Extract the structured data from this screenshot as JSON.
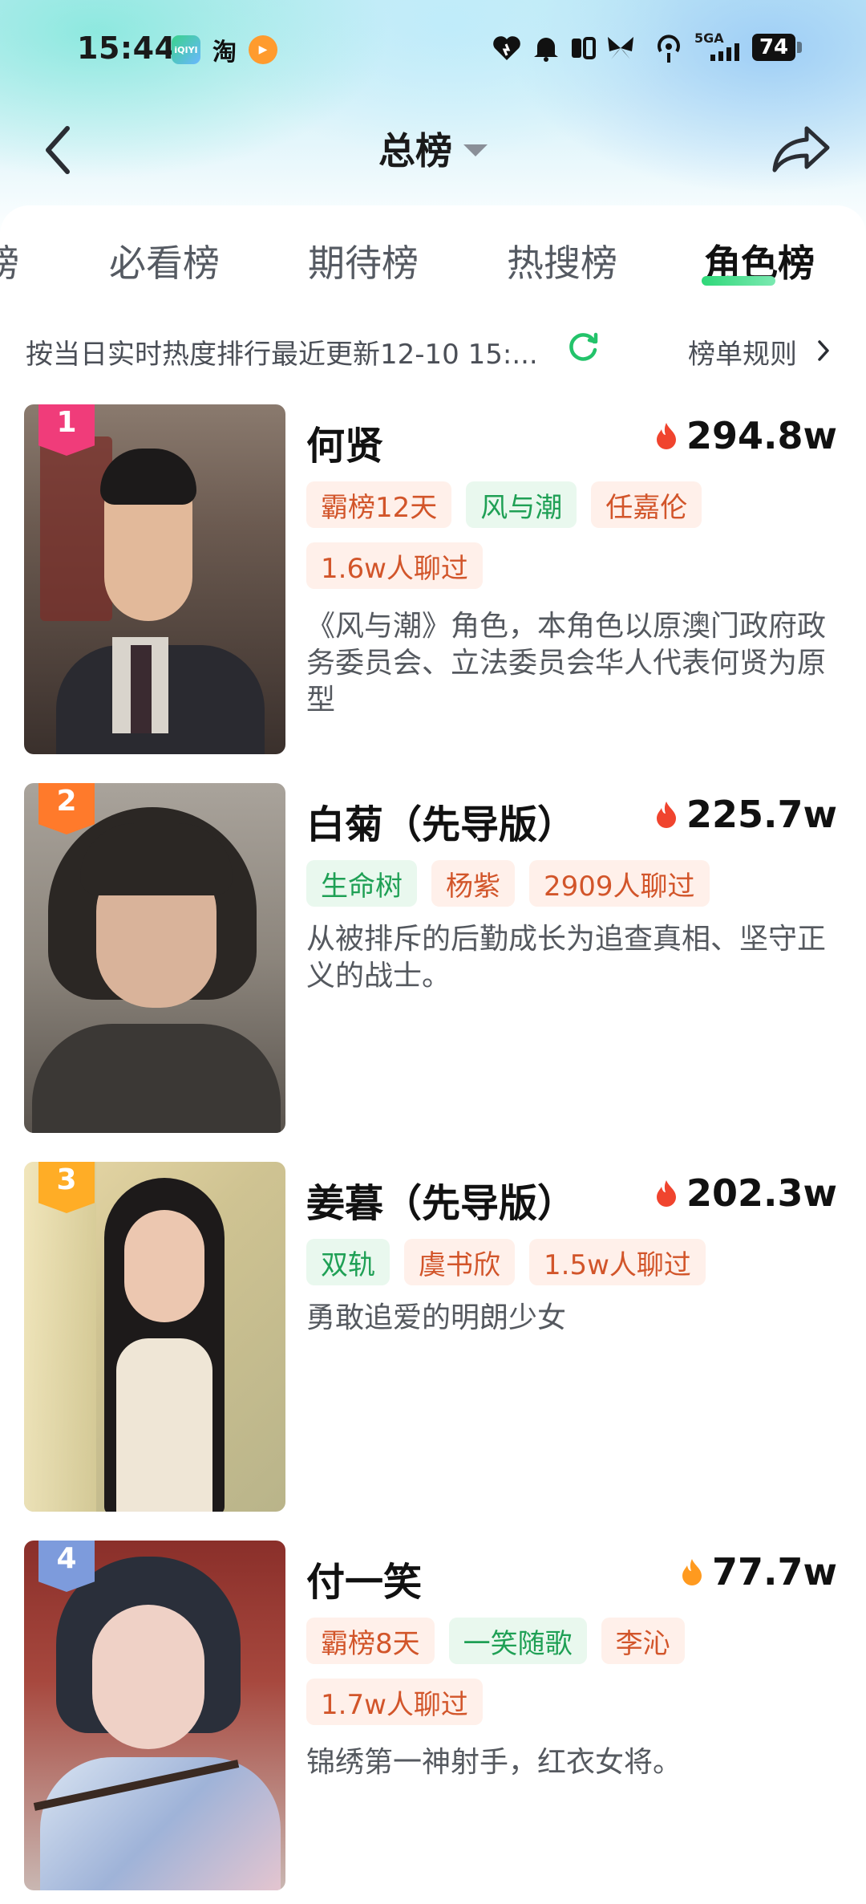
{
  "status": {
    "time": "15:44",
    "apps": [
      "iQIYI",
      "淘",
      "▶"
    ],
    "network": "5GA",
    "battery": "74"
  },
  "header": {
    "title": "总榜"
  },
  "tabs": [
    {
      "label": "榜",
      "active": false
    },
    {
      "label": "必看榜",
      "active": false
    },
    {
      "label": "期待榜",
      "active": false
    },
    {
      "label": "热搜榜",
      "active": false
    },
    {
      "label": "角色榜",
      "active": true
    }
  ],
  "info": {
    "text": "按当日实时热度排行最近更新12-10 15:...",
    "rules_label": "榜单规则"
  },
  "items": [
    {
      "rank": "1",
      "rank_color": "#f03c7a",
      "name": "何贤",
      "heat": "294.8w",
      "flame_color": "#f0442e",
      "tags": [
        {
          "text": "霸榜12天",
          "style": "o"
        },
        {
          "text": "风与潮",
          "style": "g"
        },
        {
          "text": "任嘉伦",
          "style": "o"
        },
        {
          "text": "1.6w人聊过",
          "style": "o"
        }
      ],
      "description": "《风与潮》角色，本角色以原澳门政府政务委员会、立法委员会华人代表何贤为原型"
    },
    {
      "rank": "2",
      "rank_color": "#ff7a2b",
      "name": "白菊（先导版）",
      "heat": "225.7w",
      "flame_color": "#f0442e",
      "tags": [
        {
          "text": "生命树",
          "style": "g"
        },
        {
          "text": "杨紫",
          "style": "o"
        },
        {
          "text": "2909人聊过",
          "style": "o"
        }
      ],
      "description": "从被排斥的后勤成长为追查真相、坚守正义的战士。"
    },
    {
      "rank": "3",
      "rank_color": "#ffad26",
      "name": "姜暮（先导版）",
      "heat": "202.3w",
      "flame_color": "#f0442e",
      "tags": [
        {
          "text": "双轨",
          "style": "g"
        },
        {
          "text": "虞书欣",
          "style": "o"
        },
        {
          "text": "1.5w人聊过",
          "style": "o"
        }
      ],
      "description": "勇敢追爱的明朗少女"
    },
    {
      "rank": "4",
      "rank_color": "#7d9bdc",
      "name": "付一笑",
      "heat": "77.7w",
      "flame_color": "#ff9a1f",
      "tags": [
        {
          "text": "霸榜8天",
          "style": "o"
        },
        {
          "text": "一笑随歌",
          "style": "g"
        },
        {
          "text": "李沁",
          "style": "o"
        },
        {
          "text": "1.7w人聊过",
          "style": "o"
        }
      ],
      "description": "锦绣第一神射手，红衣女将。"
    }
  ]
}
